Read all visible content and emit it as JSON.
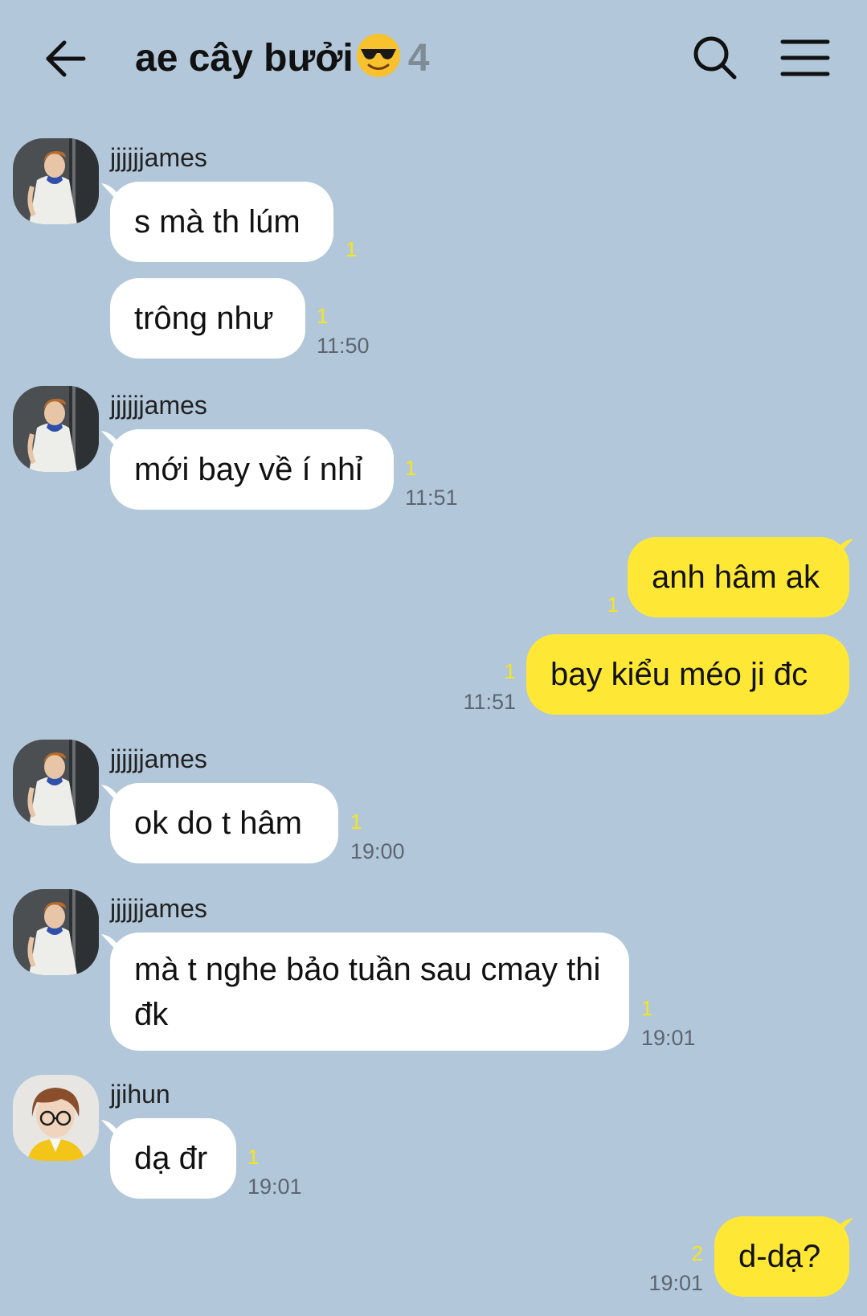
{
  "header": {
    "title": "ae cây bưởi",
    "title_emoji": "smiling-face-with-sunglasses-icon",
    "member_count": "4",
    "back_icon": "arrow-left-icon",
    "search_icon": "search-icon",
    "menu_icon": "hamburger-menu-icon"
  },
  "colors": {
    "background": "#b2c7da",
    "incoming_bubble": "#ffffff",
    "outgoing_bubble": "#fee835",
    "unread_count": "#f5e51e"
  },
  "messages": [
    {
      "sender": "jjjjjjames",
      "text": "s mà th lúm",
      "unread": "1",
      "time": ""
    },
    {
      "sender": "",
      "text": "trông như",
      "unread": "1",
      "time": "11:50"
    },
    {
      "sender": "jjjjjjames",
      "text": "mới bay về í nhỉ",
      "unread": "1",
      "time": "11:51"
    },
    {
      "sender": "me",
      "text": "anh hâm ak",
      "unread": "1",
      "time": ""
    },
    {
      "sender": "me",
      "text": "bay kiểu méo ji đc",
      "unread": "1",
      "time": "11:51"
    },
    {
      "sender": "jjjjjjames",
      "text": "ok do t hâm",
      "unread": "1",
      "time": "19:00"
    },
    {
      "sender": "jjjjjjames",
      "text": "mà t nghe bảo tuần sau cmay thi đk",
      "unread": "1",
      "time": "19:01"
    },
    {
      "sender": "jjihun",
      "text": "dạ đr",
      "unread": "1",
      "time": "19:01"
    },
    {
      "sender": "me",
      "text": "d-dạ?",
      "unread": "2",
      "time": "19:01"
    }
  ]
}
